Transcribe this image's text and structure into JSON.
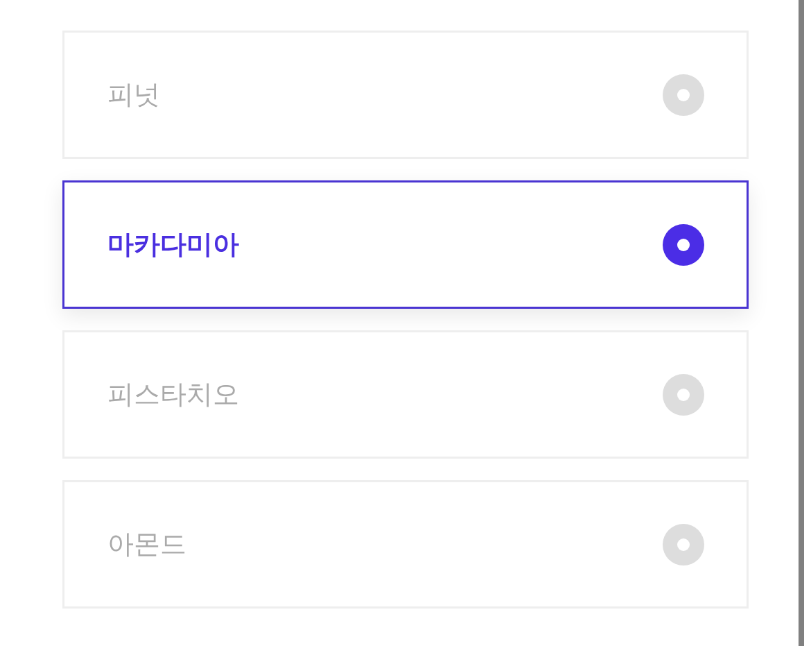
{
  "options": [
    {
      "label": "피넛",
      "selected": false
    },
    {
      "label": "마카다미아",
      "selected": true
    },
    {
      "label": "피스타치오",
      "selected": false
    },
    {
      "label": "아몬드",
      "selected": false
    }
  ]
}
